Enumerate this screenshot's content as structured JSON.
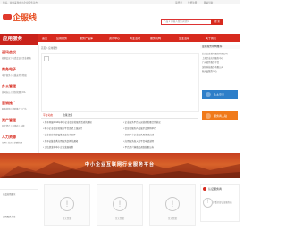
{
  "topbar": {
    "left_text": "您好，欢迎来到中小企业服务平台！",
    "right_links": [
      "请登录",
      "免费注册",
      "网站导航"
    ]
  },
  "header": {
    "logo_text": "企服线",
    "search_placeholder": "产品 ▾  请输入搜索关键词",
    "search_button": "搜 索"
  },
  "sidebar": {
    "heading": "应用服务",
    "items": [
      {
        "title": "通讯会议",
        "sub": "视频会议 | 电话会议 | 企业邮箱"
      },
      {
        "title": "商务电子",
        "sub": "电子商务 | 在线支付 | 物流"
      },
      {
        "title": "办公管理",
        "sub": "协同办公 | 财务管理 | OA"
      },
      {
        "title": "营销推广",
        "sub": "网络营销 | 搜索推广 | 广告"
      },
      {
        "title": "资产管理",
        "sub": "固定资产 | 进销存 | 仓储"
      },
      {
        "title": "人力资源",
        "sub": "招聘 | 培训 | 薪酬管理"
      }
    ],
    "bottom_items": [
      "产品应用展示",
      "应用服务大全"
    ]
  },
  "nav": {
    "items": [
      "首页",
      "应用服务",
      "服务产品库",
      "资讯中心",
      "商业活动",
      "服务机构",
      "企业活动",
      "服务平台",
      "关于我们"
    ]
  },
  "breadcrumb": "首页 > 应用服务",
  "tabs": [
    "平台动态",
    "政策法规"
  ],
  "news": [
    "• 关于开展2014年中小企业信息化服务活动的通知",
    "• 中小企业信息化服务平台正式上线运行",
    "• 企业信息化建设推进会在京召开",
    "• 关于征集优秀应用服务案例的通知",
    "• 工信部发布中小企业发展规划"
  ],
  "news_right": [
    "• 企业服务平台与运营商签署合作协议",
    "• 信息化服务产品展示会即将举行",
    "• 全国中小企业服务周活动启动",
    "• 应用服务商入驻平台申请说明",
    "• 平台用户满意度调查结果公布"
  ],
  "right_panel": {
    "head": "最新服务机构推荐",
    "lines": [
      "北京信息技术服务有限公司",
      "上海企业应用服务中心",
      "广州软件服务平台",
      "深圳科技服务有限公司",
      "杭州云服务中心"
    ],
    "btn_login": "企业登录",
    "btn_service": "服务商入驻"
  },
  "banner_text": "中小企业互联网行业服务平台",
  "cards": [
    "暂无数据",
    "暂无数据",
    "暂无数据"
  ],
  "cert": {
    "title": "认证服务商",
    "line": "查看全部认证服务商"
  },
  "colors": {
    "brand": "#d72a1e",
    "btn_blue": "#2e7fc9",
    "btn_orange": "#f07a1a"
  }
}
